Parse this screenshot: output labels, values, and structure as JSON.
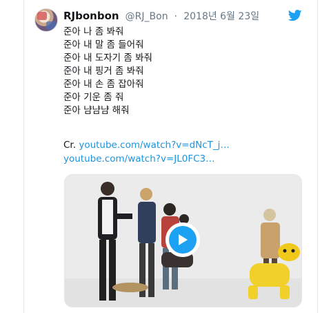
{
  "tweet": {
    "display_name": "RJbonbon",
    "handle": "@RJ_Bon",
    "separator": "·",
    "date": "2018년 6월 23일",
    "lines": [
      "준아 나 좀 봐줘",
      "준아 내 말 좀 들어줘",
      "준아 내 도자기 좀 봐줘",
      "준아 내 핑거 좀 봐줘",
      "준아 내 손 좀 잡아줘",
      "준아 기운 좀 줘",
      "준아 냠냠냠 해줘"
    ],
    "credit_prefix": "Cr.",
    "credit_link": "youtube.com/watch?v=dNcT_j…youtube.com/watch?v=JL0FC3…"
  },
  "icons": {
    "brand": "twitter-bird-icon",
    "play": "play-icon"
  },
  "colors": {
    "link": "#1b95e0",
    "brand": "#1da1f2",
    "muted": "#657786",
    "text": "#14171a"
  }
}
